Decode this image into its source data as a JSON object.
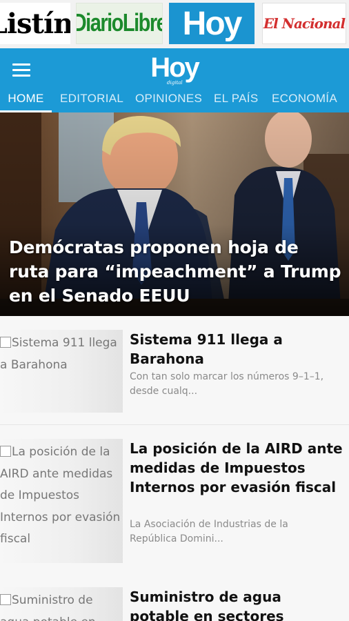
{
  "newspapers": [
    {
      "name": "Listín",
      "label": "Listín",
      "color": "#000000"
    },
    {
      "name": "Diario Libre",
      "label": "DiarioLibre",
      "color": "#1c8a2c"
    },
    {
      "name": "Hoy",
      "label": "Hoy",
      "color": "#1b94d0"
    },
    {
      "name": "El Nacional",
      "label": "El Nacional",
      "color": "#d32f2f"
    }
  ],
  "appbar": {
    "menu_icon": "hamburger-menu-icon",
    "logo": "Hoy",
    "logo_sub": "digital",
    "color": "#1c9ad6"
  },
  "tabs": [
    {
      "label": "HOME",
      "active": true
    },
    {
      "label": "EDITORIAL",
      "active": false
    },
    {
      "label": "OPINIONES",
      "active": false
    },
    {
      "label": "EL PAÍS",
      "active": false
    },
    {
      "label": "ECONOMÍA",
      "active": false
    }
  ],
  "hero": {
    "title": "Demócratas proponen hoja de ruta para “impeachment” a Trump en el Senado EEUU"
  },
  "articles": [
    {
      "image_alt": "Sistema 911 llega a Barahona",
      "title": "Sistema 911 llega a Barahona",
      "excerpt": "Con tan solo marcar los números 9–1–1, desde cualq..."
    },
    {
      "image_alt": "La posición de la AIRD ante medidas de Impuestos Internos por evasión fiscal",
      "title": "La posición de la AIRD ante medidas de Impuestos Internos por evasión fiscal",
      "excerpt": "La Asociación de Industrias de la República Domini..."
    },
    {
      "image_alt": "Suministro de agua potable en",
      "title": "Suministro de agua potable en sectores afectados podría",
      "excerpt": ""
    }
  ]
}
